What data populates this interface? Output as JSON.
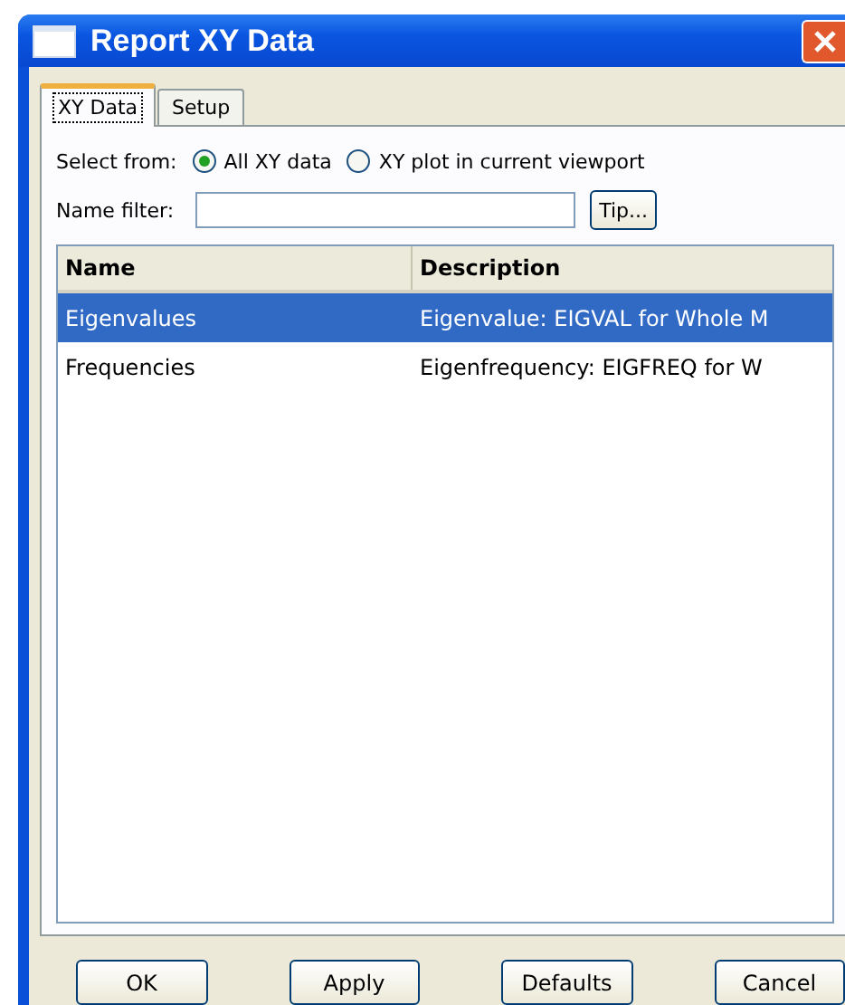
{
  "window": {
    "title": "Report XY Data"
  },
  "tabs": [
    {
      "label": "XY Data",
      "selected": true
    },
    {
      "label": "Setup",
      "selected": false
    }
  ],
  "select_from": {
    "label": "Select from:",
    "options": [
      {
        "label": "All XY data",
        "selected": true
      },
      {
        "label": "XY plot in current viewport",
        "selected": false
      }
    ]
  },
  "name_filter": {
    "label": "Name filter:",
    "button": "Tip..."
  },
  "table": {
    "columns": [
      "Name",
      "Description"
    ],
    "rows": [
      {
        "cells": [
          "Eigenvalues",
          "Eigenvalue: EIGVAL for Whole M"
        ],
        "selected": true
      },
      {
        "cells": [
          "Frequencies",
          "Eigenfrequency: EIGFREQ for W"
        ],
        "selected": false
      }
    ]
  },
  "buttons": [
    "OK",
    "Apply",
    "Defaults",
    "Cancel"
  ]
}
